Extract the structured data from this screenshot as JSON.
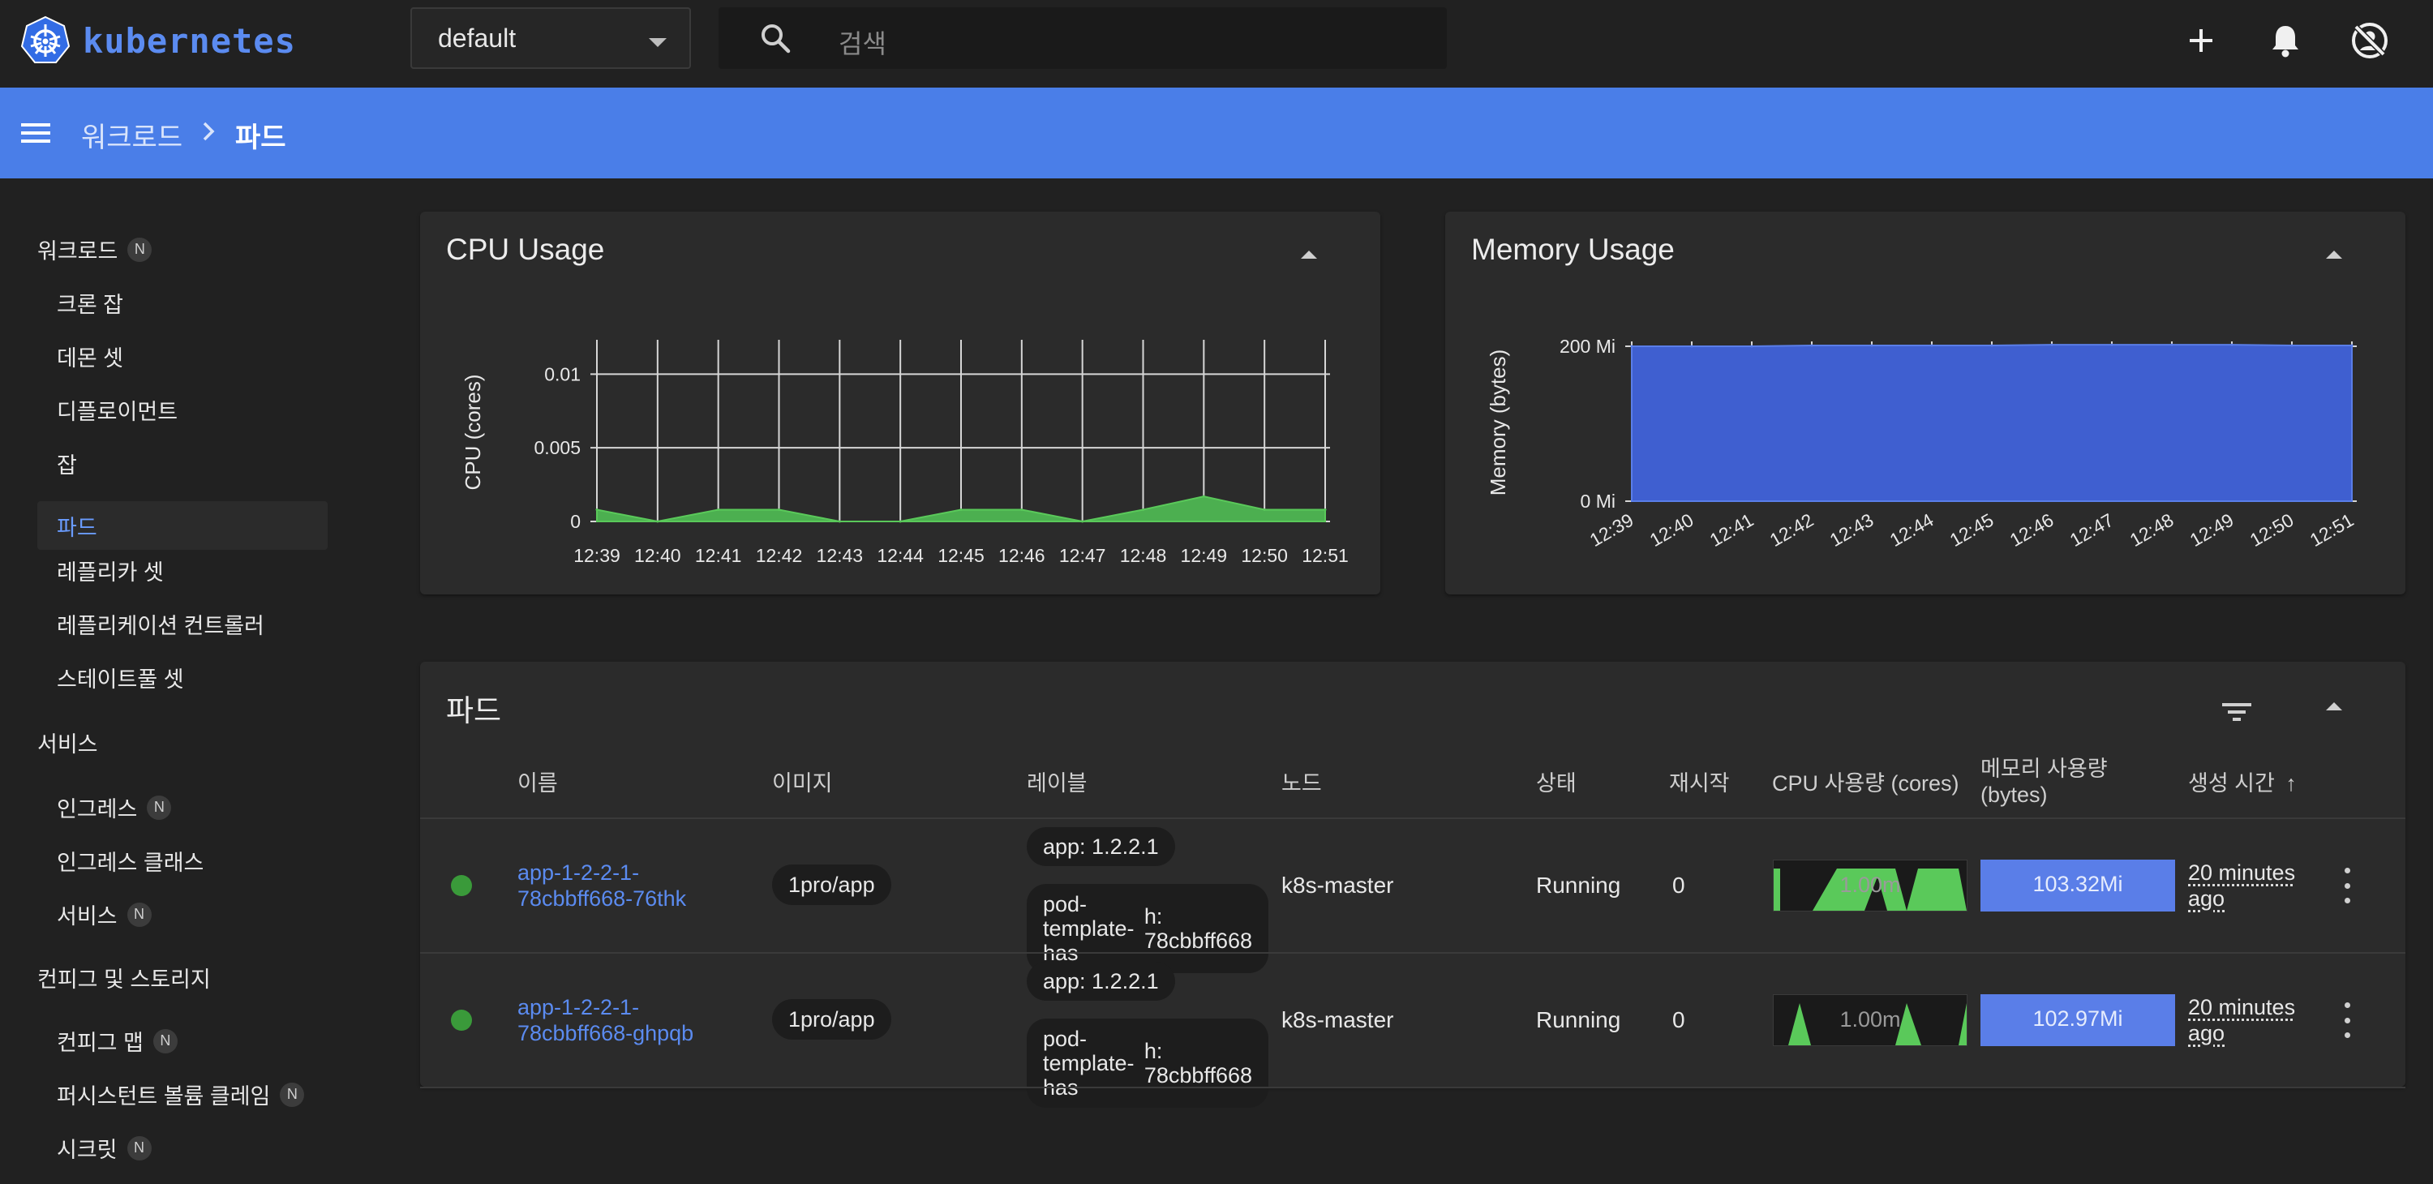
{
  "app": {
    "name": "kubernetes"
  },
  "namespace": {
    "selected": "default"
  },
  "search": {
    "placeholder": "검색"
  },
  "breadcrumb": {
    "parent": "워크로드",
    "current": "파드"
  },
  "sidebar": {
    "sections": [
      {
        "label": "워크로드",
        "badge": "N",
        "items": [
          {
            "label": "크론 잡"
          },
          {
            "label": "데몬 셋"
          },
          {
            "label": "디플로이먼트"
          },
          {
            "label": "잡"
          },
          {
            "label": "파드",
            "active": true
          },
          {
            "label": "레플리카 셋"
          },
          {
            "label": "레플리케이션 컨트롤러"
          },
          {
            "label": "스테이트풀 셋"
          }
        ]
      },
      {
        "label": "서비스",
        "items": [
          {
            "label": "인그레스",
            "badge": "N"
          },
          {
            "label": "인그레스 클래스"
          },
          {
            "label": "서비스",
            "badge": "N"
          }
        ]
      },
      {
        "label": "컨피그 및 스토리지",
        "items": [
          {
            "label": "컨피그 맵",
            "badge": "N"
          },
          {
            "label": "퍼시스턴트 볼륨 클레임",
            "badge": "N"
          },
          {
            "label": "시크릿",
            "badge": "N"
          }
        ]
      }
    ]
  },
  "colors": {
    "accent": "#4a7ee8",
    "cpu_series": "#4caf50",
    "memory_series": "#3f5fd0",
    "running": "#3a9a3a"
  },
  "chart_data": [
    {
      "type": "area",
      "title": "CPU Usage",
      "ylabel": "CPU (cores)",
      "x": [
        "12:39",
        "12:40",
        "12:41",
        "12:42",
        "12:43",
        "12:44",
        "12:45",
        "12:46",
        "12:47",
        "12:48",
        "12:49",
        "12:50",
        "12:51"
      ],
      "y_ticks": [
        "0",
        "0.005",
        "0.01"
      ],
      "ylim": [
        0,
        0.012
      ],
      "series": [
        {
          "values": [
            0.0008,
            0.0,
            0.0008,
            0.0008,
            0.0,
            0.0,
            0.0008,
            0.0008,
            0.0,
            0.0008,
            0.0017,
            0.0008,
            0.0008
          ]
        }
      ],
      "grid": true
    },
    {
      "type": "area",
      "title": "Memory Usage",
      "ylabel": "Memory (bytes)",
      "x": [
        "12:39",
        "12:40",
        "12:41",
        "12:42",
        "12:43",
        "12:44",
        "12:45",
        "12:46",
        "12:47",
        "12:48",
        "12:49",
        "12:50",
        "12:51"
      ],
      "y_ticks": [
        "0 Mi",
        "200 Mi"
      ],
      "ylim": [
        0,
        200
      ],
      "series": [
        {
          "values": [
            200,
            200,
            200,
            201,
            201,
            201,
            201,
            202,
            202,
            202,
            202,
            201,
            201
          ]
        }
      ],
      "grid": true
    }
  ],
  "pods": {
    "title": "파드",
    "columns": {
      "name": "이름",
      "image": "이미지",
      "labels": "레이블",
      "node": "노드",
      "status": "상태",
      "restarts": "재시작",
      "cpu": "CPU 사용량 (cores)",
      "memory_l1": "메모리 사용량",
      "memory_l2": "(bytes)",
      "created": "생성 시간",
      "sort_arrow": "↑"
    },
    "rows": [
      {
        "name_l1": "app-1-2-2-1-",
        "name_l2": "78cbbff668-76thk",
        "image": "1pro/app",
        "label1": "app: 1.2.2.1",
        "label2_l1": "pod-template-has",
        "label2_l2": "h: 78cbbff668",
        "node": "k8s-master",
        "status": "Running",
        "restarts": "0",
        "cpu": "1.00m",
        "memory": "103.32Mi",
        "age_l1": "20 minutes",
        "age_l2": "ago"
      },
      {
        "name_l1": "app-1-2-2-1-",
        "name_l2": "78cbbff668-ghpqb",
        "image": "1pro/app",
        "label1": "app: 1.2.2.1",
        "label2_l1": "pod-template-has",
        "label2_l2": "h: 78cbbff668",
        "node": "k8s-master",
        "status": "Running",
        "restarts": "0",
        "cpu": "1.00m",
        "memory": "102.97Mi",
        "age_l1": "20 minutes",
        "age_l2": "ago"
      }
    ]
  }
}
